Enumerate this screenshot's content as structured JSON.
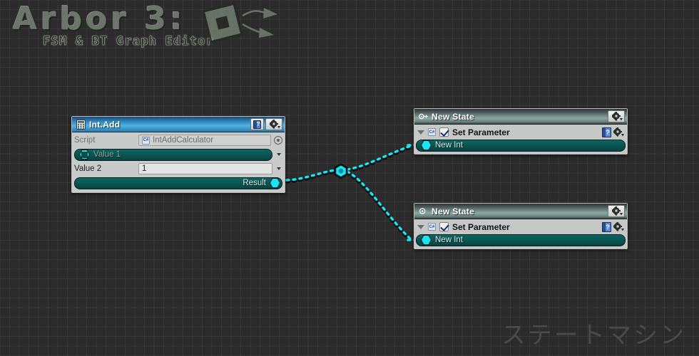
{
  "app": {
    "logo_main": "Arbor 3:",
    "logo_sub": "FSM & BT Graph Editor",
    "watermark": "ステートマシン"
  },
  "theme": {
    "canvas_bg": "#2b2b2b",
    "grid_line": "#3d3d3d",
    "accent_cyan": "#19e4f2",
    "slot_teal": "#0a5652",
    "header_blue": "#2d7fb8",
    "header_grey": "#8aa8a4"
  },
  "calculator_node": {
    "title": "Int.Add",
    "icon": "calculator-icon",
    "help_label": "?",
    "gear_label": "gear",
    "script": {
      "label": "Script",
      "value": "IntAddCalculator",
      "badge": "C#",
      "picker": "target-icon"
    },
    "value1": {
      "label": "Value 1",
      "port": "input-port"
    },
    "value2": {
      "label": "Value 2",
      "value": "1"
    },
    "result": {
      "label": "Result",
      "port": "output-port"
    }
  },
  "state_nodes": [
    {
      "title": "New State",
      "icon": "start-state-icon",
      "behaviour": {
        "title": "Set Parameter",
        "badge": "C#",
        "checked": true,
        "slot_label": "New Int"
      }
    },
    {
      "title": "New State",
      "icon": "state-icon",
      "behaviour": {
        "title": "Set Parameter",
        "badge": "C#",
        "checked": true,
        "slot_label": "New Int"
      }
    }
  ],
  "connections": {
    "junction": "wire-junction-node",
    "count": 2
  }
}
